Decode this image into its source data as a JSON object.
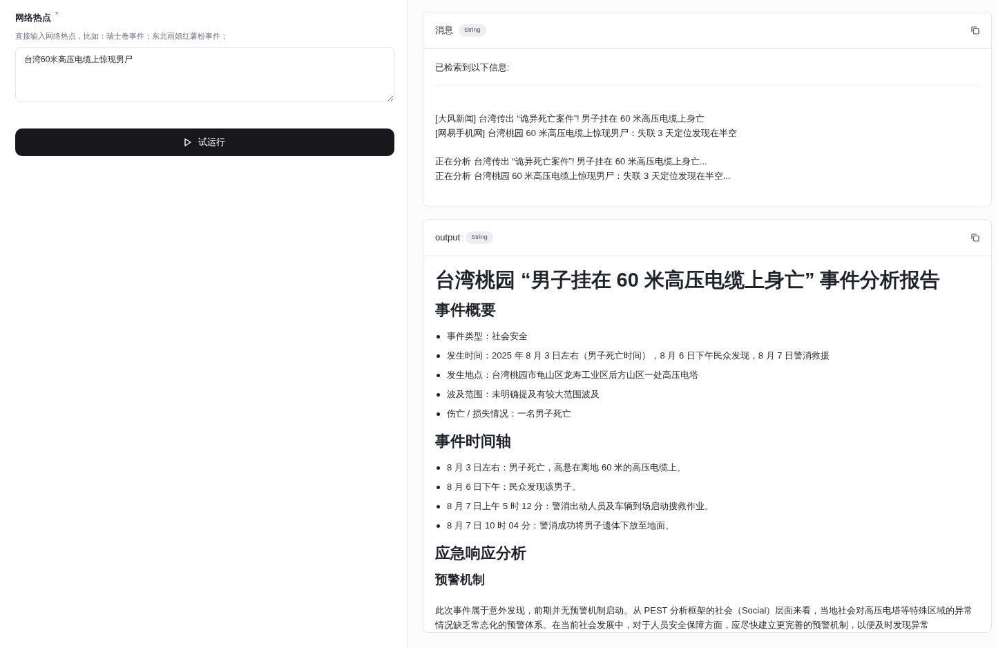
{
  "form": {
    "label": "网络热点",
    "required_mark": "*",
    "hint": "直接输入网络热点，比如：瑞士卷事件；东北雨姐红薯粉事件；",
    "value": "台湾60米高压电缆上惊现男尸",
    "run_button": {
      "label": "试运行"
    }
  },
  "outputs": [
    {
      "title": "消息",
      "type": "String",
      "blocks": [
        {
          "kind": "text",
          "text": "已检索到以下信息:"
        },
        {
          "kind": "rule"
        },
        {
          "kind": "lines",
          "lines": [
            "[大风新闻] 台湾传出 “诡异死亡案件”! 男子挂在 60 米高压电缆上身亡",
            "[网易手机网] 台湾桃园 60 米高压电缆上惊现男尸：失联 3 天定位发现在半空"
          ]
        },
        {
          "kind": "lines",
          "lines": [
            "正在分析 台湾传出 “诡异死亡案件”! 男子挂在 60 米高压电缆上身亡...",
            "正在分析 台湾桃园 60 米高压电缆上惊现男尸：失联 3 天定位发现在半空..."
          ]
        }
      ]
    },
    {
      "title": "output",
      "type": "String",
      "blocks": [
        {
          "kind": "h1",
          "text": "台湾桃园 “男子挂在 60 米高压电缆上身亡” 事件分析报告"
        },
        {
          "kind": "h2",
          "text": "事件概要"
        },
        {
          "kind": "list",
          "items": [
            "事件类型：社会安全",
            "发生时间：2025 年 8 月 3 日左右（男子死亡时间），8 月 6 日下午民众发现，8 月 7 日警消救援",
            "发生地点：台湾桃园市龟山区龙寿工业区后方山区一处高压电塔",
            "波及范围：未明确提及有较大范围波及",
            "伤亡 / 损失情况：一名男子死亡"
          ]
        },
        {
          "kind": "h2",
          "text": "事件时间轴"
        },
        {
          "kind": "list",
          "items": [
            "8 月 3 日左右：男子死亡，高悬在离地 60 米的高压电缆上。",
            "8 月 6 日下午：民众发现该男子。",
            "8 月 7 日上午 5 时 12 分：警消出动人员及车辆到场启动搜救作业。",
            "8 月 7 日 10 时 04 分：警消成功将男子遗体下放至地面。"
          ]
        },
        {
          "kind": "h2",
          "text": "应急响应分析"
        },
        {
          "kind": "h3",
          "text": "预警机制"
        },
        {
          "kind": "text",
          "text": "此次事件属于意外发现，前期并无预警机制启动。从 PEST 分析框架的社会（Social）层面来看，当地社会对高压电塔等特殊区域的异常情况缺乏常态化的预警体系。在当前社会发展中，对于人员安全保障方面，应尽快建立更完善的预警机制，以便及时发现异常"
        }
      ]
    }
  ]
}
